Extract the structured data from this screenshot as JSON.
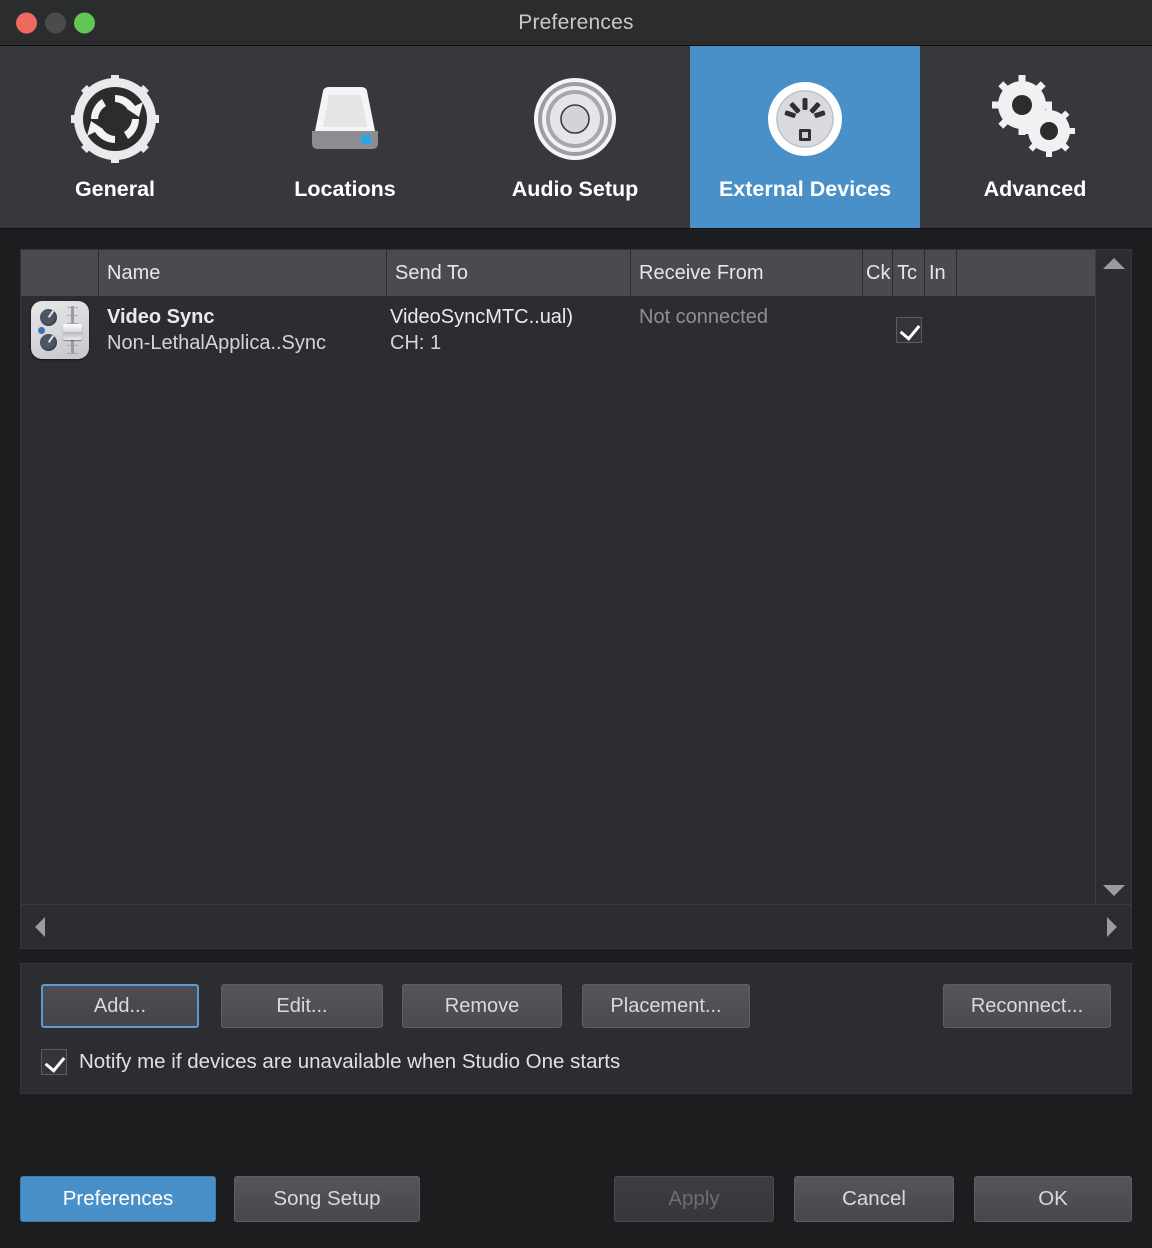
{
  "window": {
    "title": "Preferences",
    "traffic_lights": [
      "close-button",
      "minimize-button",
      "zoom-button"
    ]
  },
  "toolbar": {
    "items": [
      {
        "label": "General",
        "icon": "gear-refresh-icon",
        "selected": false
      },
      {
        "label": "Locations",
        "icon": "hard-drive-icon",
        "selected": false
      },
      {
        "label": "Audio Setup",
        "icon": "audio-device-icon",
        "selected": false
      },
      {
        "label": "External Devices",
        "icon": "midi-port-icon",
        "selected": true
      },
      {
        "label": "Advanced",
        "icon": "double-gears-icon",
        "selected": false
      }
    ],
    "selected_accent": "#4a90c8"
  },
  "device_table": {
    "columns": [
      {
        "key": "icon",
        "label": ""
      },
      {
        "key": "name",
        "label": "Name"
      },
      {
        "key": "send_to",
        "label": "Send To"
      },
      {
        "key": "receive_from",
        "label": "Receive From"
      },
      {
        "key": "ck",
        "label": "Ck"
      },
      {
        "key": "tc",
        "label": "Tc"
      },
      {
        "key": "in",
        "label": "In"
      },
      {
        "key": "pad",
        "label": ""
      }
    ],
    "rows": [
      {
        "icon": "midi-device-icon",
        "name_primary": "Video Sync",
        "name_secondary": "Non-LethalApplica..Sync",
        "send_to_primary": "VideoSyncMTC..ual)",
        "send_to_secondary": "CH: 1",
        "receive_from": "Not connected",
        "ck_checked": false,
        "tc_checked": true,
        "in_checked": false
      }
    ],
    "scrollbars": {
      "vertical_up": "scroll-up-arrow",
      "vertical_down": "scroll-down-arrow",
      "horizontal_left": "scroll-left-arrow",
      "horizontal_right": "scroll-right-arrow"
    }
  },
  "actions": {
    "add_label": "Add...",
    "edit_label": "Edit...",
    "remove_label": "Remove",
    "placement_label": "Placement...",
    "reconnect_label": "Reconnect...",
    "notify_label": "Notify me if devices are unavailable when Studio One starts",
    "notify_checked": true,
    "focused_button": "Add..."
  },
  "footer": {
    "preferences_label": "Preferences",
    "song_setup_label": "Song Setup",
    "apply_label": "Apply",
    "apply_enabled": false,
    "cancel_label": "Cancel",
    "ok_label": "OK",
    "active_tab": "Preferences"
  }
}
